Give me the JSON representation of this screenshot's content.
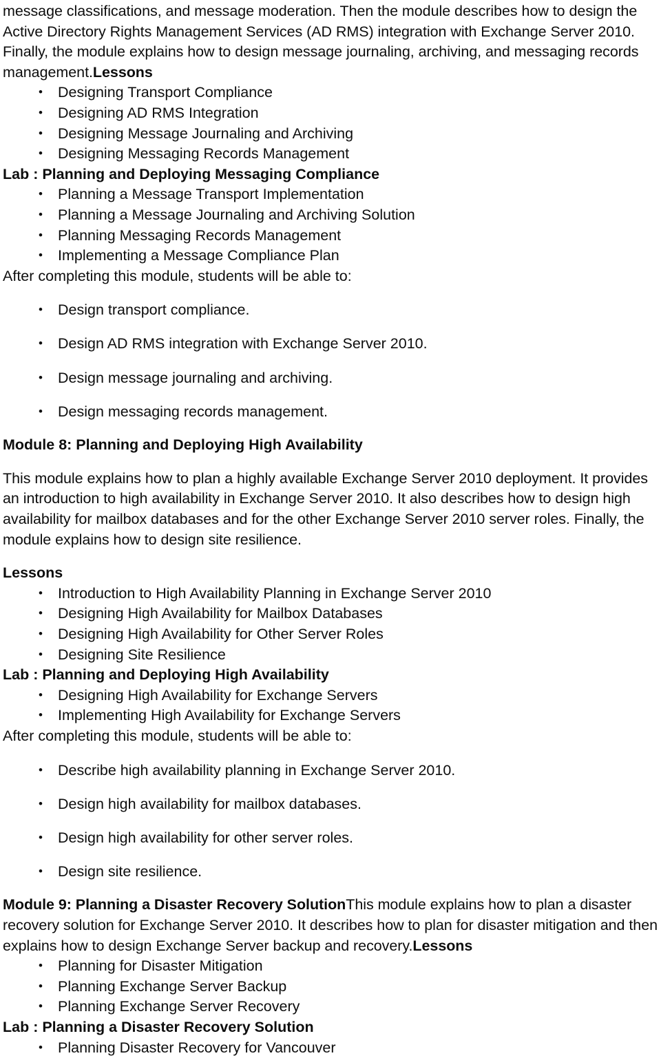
{
  "document": {
    "type": "course-outline",
    "subject": "Exchange Server 2010 training course outline",
    "text_color": "#0d0d0d",
    "background_color": "#ffffff"
  },
  "blocks": {
    "intro_paragraph": {
      "continued_text": "message classifications, and message moderation. Then the module describes how to design the Active Directory Rights Management Services (AD RMS) integration with Exchange Server 2010. Finally, the module explains how to design message journaling, archiving, and messaging records management.",
      "inline_heading": "Lessons"
    },
    "module7_lessons": [
      "Designing Transport Compliance",
      "Designing AD RMS Integration",
      "Designing Message Journaling and Archiving",
      "Designing Messaging Records Management"
    ],
    "module7_lab_heading": "Lab : Planning and Deploying Messaging Compliance",
    "module7_lab_items": [
      "Planning a Message Transport Implementation",
      "Planning a Message Journaling and Archiving Solution",
      "Planning Messaging Records Management",
      "Implementing a Message Compliance Plan"
    ],
    "module7_objectives_intro": "After completing this module, students will be able to:",
    "module7_objectives": [
      "Design transport compliance.",
      "Design AD RMS integration with Exchange Server 2010.",
      "Design message journaling and archiving.",
      "Design messaging records management."
    ],
    "module8_heading": "Module 8: Planning and Deploying High Availability",
    "module8_description": "This module explains how to plan a highly available Exchange Server 2010 deployment. It provides an introduction to high availability in Exchange Server 2010. It also describes how to design high availability for mailbox databases and for the other Exchange Server 2010 server roles. Finally, the module explains how to design site resilience.",
    "module8_lessons_heading": "Lessons",
    "module8_lessons": [
      "Introduction to High Availability Planning in Exchange Server 2010",
      "Designing High Availability for Mailbox Databases",
      "Designing High Availability for Other Server Roles",
      "Designing Site Resilience"
    ],
    "module8_lab_heading": "Lab : Planning and Deploying High Availability",
    "module8_lab_items": [
      "Designing High Availability for Exchange Servers",
      "Implementing High Availability for Exchange Servers"
    ],
    "module8_objectives_intro": "After completing this module, students will be able to:",
    "module8_objectives": [
      "Describe high availability planning in Exchange Server 2010.",
      "Design high availability for mailbox databases.",
      "Design high availability for other server roles.",
      "Design site resilience."
    ],
    "module9_heading": "Module 9: Planning a Disaster Recovery Solution",
    "module9_description": "This module explains how to plan a disaster recovery solution for Exchange Server 2010. It describes how to plan for disaster mitigation and then explains how to design Exchange Server backup and recovery.",
    "module9_lessons_inline_heading": "Lessons",
    "module9_lessons": [
      "Planning for Disaster Mitigation",
      "Planning Exchange Server Backup",
      "Planning Exchange Server Recovery"
    ],
    "module9_lab_heading": "Lab : Planning a Disaster Recovery Solution",
    "module9_lab_items": [
      "Planning Disaster Recovery for Vancouver"
    ]
  }
}
